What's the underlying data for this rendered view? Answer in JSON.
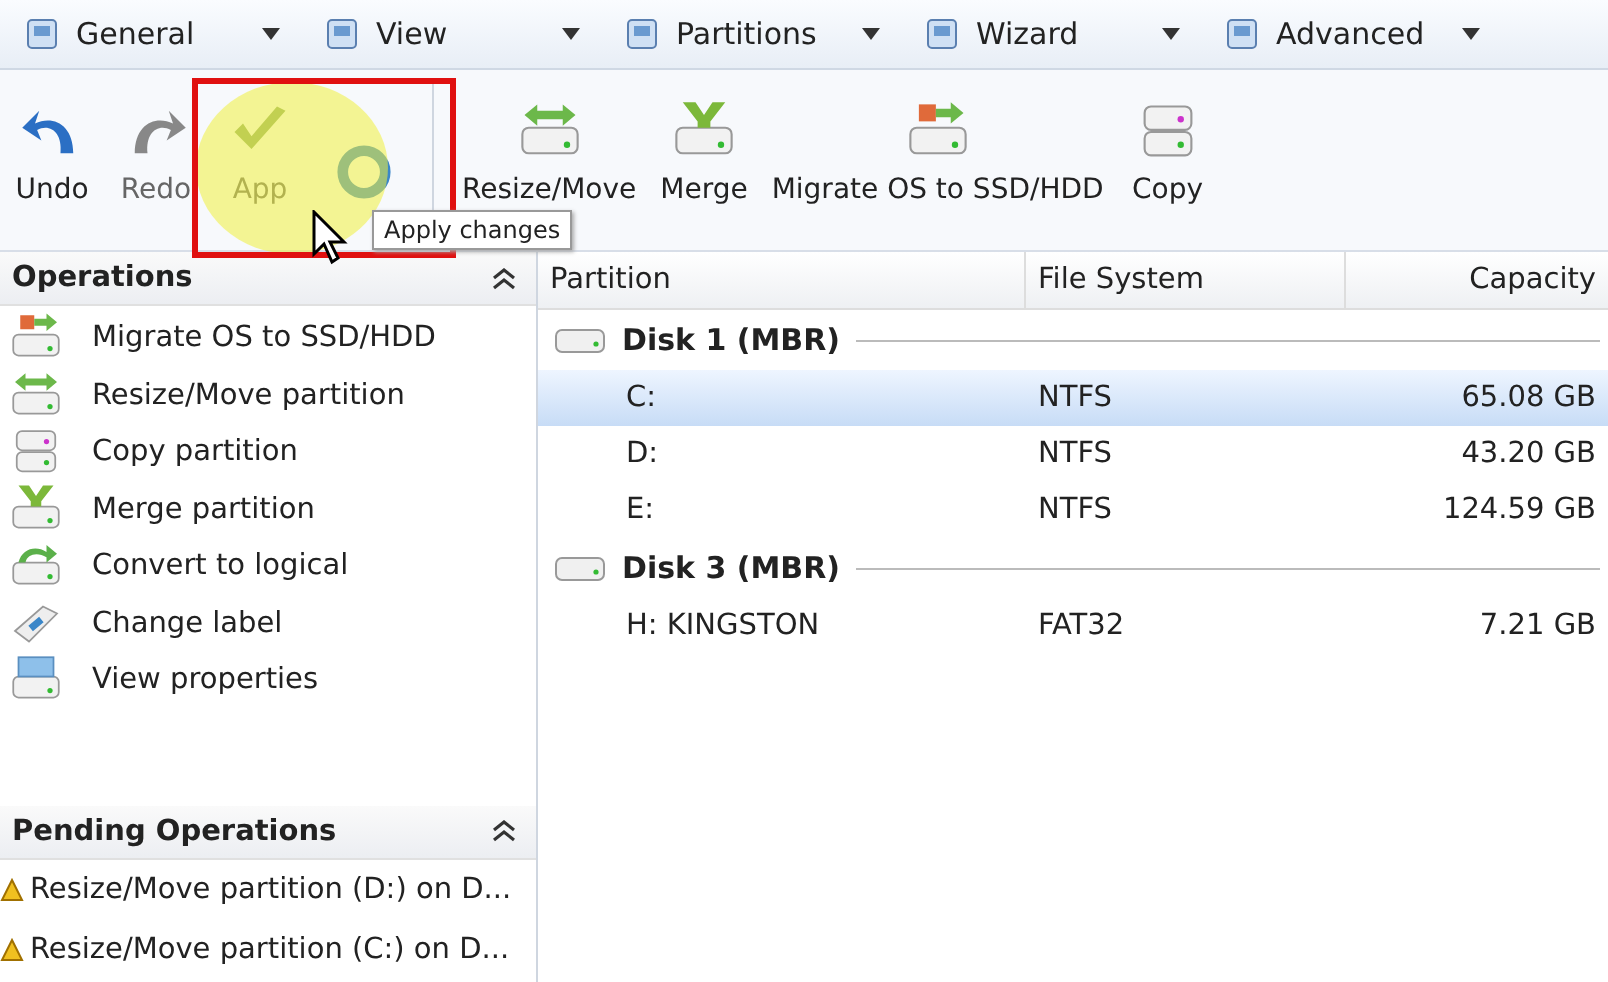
{
  "menu": [
    {
      "label": "General"
    },
    {
      "label": "View"
    },
    {
      "label": "Partitions"
    },
    {
      "label": "Wizard"
    },
    {
      "label": "Advanced"
    }
  ],
  "toolbar": [
    {
      "kind": "undo",
      "label": "Undo",
      "disabled": false
    },
    {
      "kind": "redo",
      "label": "Redo",
      "disabled": true
    },
    {
      "kind": "apply",
      "label": "App",
      "disabled": true
    },
    {
      "kind": "refresh"
    },
    {
      "kind": "resize",
      "label": "Resize/Move",
      "disabled": false
    },
    {
      "kind": "merge",
      "label": "Merge",
      "disabled": false
    },
    {
      "kind": "migrate",
      "label": "Migrate OS to SSD/HDD",
      "disabled": false
    },
    {
      "kind": "copy",
      "label": "Copy",
      "disabled": false
    }
  ],
  "tooltip": "Apply changes",
  "operations": {
    "title": "Operations",
    "items": [
      {
        "kind": "migrate",
        "label": "Migrate OS to SSD/HDD"
      },
      {
        "kind": "resize",
        "label": "Resize/Move partition"
      },
      {
        "kind": "copy",
        "label": "Copy partition"
      },
      {
        "kind": "merge",
        "label": "Merge partition"
      },
      {
        "kind": "convert",
        "label": "Convert to logical"
      },
      {
        "kind": "label",
        "label": "Change label"
      },
      {
        "kind": "properties",
        "label": "View properties"
      }
    ]
  },
  "pending": {
    "title": "Pending Operations",
    "items": [
      "Resize/Move partition (D:) on D...",
      "Resize/Move partition (C:) on D..."
    ]
  },
  "table": {
    "columns": [
      "Partition",
      "File System",
      "Capacity"
    ],
    "disks": [
      {
        "name": "Disk 1 (MBR)",
        "partitions": [
          {
            "partition": "C:",
            "fs": "NTFS",
            "capacity": "65.08 GB",
            "selected": true
          },
          {
            "partition": "D:",
            "fs": "NTFS",
            "capacity": "43.20 GB",
            "selected": false
          },
          {
            "partition": "E:",
            "fs": "NTFS",
            "capacity": "124.59 GB",
            "selected": false
          }
        ]
      },
      {
        "name": "Disk 3 (MBR)",
        "partitions": [
          {
            "partition": "H: KINGSTON",
            "fs": "FAT32",
            "capacity": "7.21 GB",
            "selected": false
          }
        ]
      }
    ]
  }
}
